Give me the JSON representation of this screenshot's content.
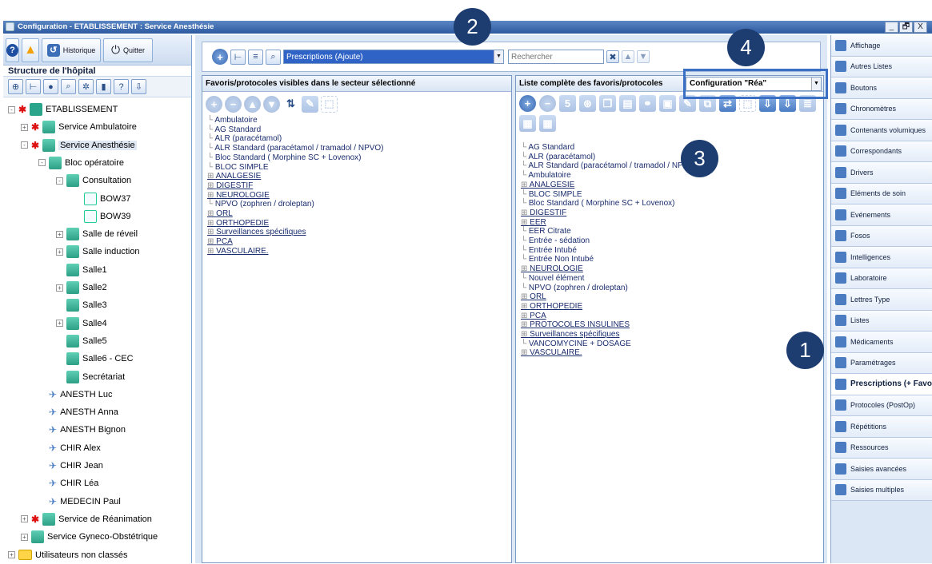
{
  "window": {
    "title": "Configuration - ETABLISSEMENT : Service Anesthésie",
    "buttons": [
      "_",
      "🗗",
      "X"
    ]
  },
  "left": {
    "historique_label": "Historique",
    "quitter_label": "Quitter",
    "structure_header": "Structure de l'hôpital",
    "tree": [
      {
        "label": "ETABLISSEMENT",
        "level": 0,
        "exp": "-",
        "icon": "establishment"
      },
      {
        "label": "Service Ambulatoire",
        "level": 1,
        "exp": "+",
        "icon": "service"
      },
      {
        "label": "Service Anesthésie",
        "level": 1,
        "exp": "-",
        "icon": "service",
        "selected": true
      },
      {
        "label": "Bloc opératoire",
        "level": 2,
        "exp": "-",
        "icon": "bloc"
      },
      {
        "label": "Consultation",
        "level": 3,
        "exp": "-",
        "icon": "room"
      },
      {
        "label": "BOW37",
        "level": 4,
        "exp": "",
        "icon": "desk"
      },
      {
        "label": "BOW39",
        "level": 4,
        "exp": "",
        "icon": "desk"
      },
      {
        "label": "Salle de réveil",
        "level": 3,
        "exp": "+",
        "icon": "room"
      },
      {
        "label": "Salle induction",
        "level": 3,
        "exp": "+",
        "icon": "room"
      },
      {
        "label": "Salle1",
        "level": 3,
        "exp": "",
        "icon": "room"
      },
      {
        "label": "Salle2",
        "level": 3,
        "exp": "+",
        "icon": "room"
      },
      {
        "label": "Salle3",
        "level": 3,
        "exp": "",
        "icon": "room"
      },
      {
        "label": "Salle4",
        "level": 3,
        "exp": "+",
        "icon": "room"
      },
      {
        "label": "Salle5",
        "level": 3,
        "exp": "",
        "icon": "room"
      },
      {
        "label": "Salle6 - CEC",
        "level": 3,
        "exp": "",
        "icon": "room"
      },
      {
        "label": "Secrétariat",
        "level": 3,
        "exp": "",
        "icon": "room"
      },
      {
        "label": "ANESTH Luc",
        "level": 2,
        "exp": "",
        "icon": "person"
      },
      {
        "label": "ANESTH Anna",
        "level": 2,
        "exp": "",
        "icon": "person"
      },
      {
        "label": "ANESTH Bignon",
        "level": 2,
        "exp": "",
        "icon": "person"
      },
      {
        "label": "CHIR Alex",
        "level": 2,
        "exp": "",
        "icon": "person"
      },
      {
        "label": "CHIR Jean",
        "level": 2,
        "exp": "",
        "icon": "person"
      },
      {
        "label": "CHIR Léa",
        "level": 2,
        "exp": "",
        "icon": "person"
      },
      {
        "label": "MEDECIN Paul",
        "level": 2,
        "exp": "",
        "icon": "person"
      },
      {
        "label": "Service de Réanimation",
        "level": 1,
        "exp": "+",
        "icon": "service"
      },
      {
        "label": "Service Gyneco-Obstétrique",
        "level": 1,
        "exp": "+",
        "icon": "service-plain"
      },
      {
        "label": "Utilisateurs non classés",
        "level": 0,
        "exp": "+",
        "icon": "folder"
      }
    ]
  },
  "main": {
    "prescriptions_combo": "Prescriptions (Ajoute)",
    "search_placeholder": "Rechercher",
    "panel_a_title": "Favoris/protocoles visibles dans le secteur sélectionné",
    "panel_b_title": "Liste complète des favoris/protocoles",
    "config_combo": "Configuration \"Réa\"",
    "list_a": [
      {
        "t": "Ambulatoire",
        "g": false
      },
      {
        "t": "AG Standard",
        "g": false
      },
      {
        "t": "ALR (paracétamol)",
        "g": false
      },
      {
        "t": "ALR Standard (paracétamol / tramadol / NPVO)",
        "g": false
      },
      {
        "t": "Bloc Standard ( Morphine SC + Lovenox)",
        "g": false
      },
      {
        "t": "BLOC SIMPLE",
        "g": false
      },
      {
        "t": "ANALGESIE",
        "g": true
      },
      {
        "t": "DIGESTIF",
        "g": true
      },
      {
        "t": "NEUROLOGIE",
        "g": true
      },
      {
        "t": "NPVO (zophren / droleptan)",
        "g": false
      },
      {
        "t": "ORL",
        "g": true
      },
      {
        "t": "ORTHOPEDIE",
        "g": true
      },
      {
        "t": "Surveillances spécifiques",
        "g": true
      },
      {
        "t": "PCA",
        "g": true
      },
      {
        "t": "VASCULAIRE.",
        "g": true
      }
    ],
    "list_b": [
      {
        "t": "AG Standard",
        "g": false
      },
      {
        "t": "ALR (paracétamol)",
        "g": false
      },
      {
        "t": "ALR Standard (paracétamol / tramadol / NPVO)",
        "g": false
      },
      {
        "t": "Ambulatoire",
        "g": false
      },
      {
        "t": "ANALGESIE",
        "g": true
      },
      {
        "t": "BLOC SIMPLE",
        "g": false
      },
      {
        "t": "Bloc Standard ( Morphine SC + Lovenox)",
        "g": false
      },
      {
        "t": "DIGESTIF",
        "g": true
      },
      {
        "t": "EER",
        "g": true
      },
      {
        "t": "EER Citrate",
        "g": false
      },
      {
        "t": "Entrée - sédation",
        "g": false
      },
      {
        "t": "Entrée Intubé",
        "g": false
      },
      {
        "t": "Entrée Non Intubé",
        "g": false
      },
      {
        "t": "NEUROLOGIE",
        "g": true
      },
      {
        "t": "Nouvel élément",
        "g": false
      },
      {
        "t": "NPVO (zophren / droleptan)",
        "g": false
      },
      {
        "t": "ORL",
        "g": true
      },
      {
        "t": "ORTHOPEDIE",
        "g": true
      },
      {
        "t": "PCA",
        "g": true
      },
      {
        "t": "PROTOCOLES INSULINES",
        "g": true
      },
      {
        "t": "Surveillances spécifiques",
        "g": true
      },
      {
        "t": "VANCOMYCINE + DOSAGE",
        "g": false
      },
      {
        "t": "VASCULAIRE.",
        "g": true
      }
    ]
  },
  "right": {
    "items": [
      {
        "label": "Affichage",
        "icon": "display-icon"
      },
      {
        "label": "Autres Listes",
        "icon": "list-icon"
      },
      {
        "label": "Boutons",
        "icon": "buttons-icon"
      },
      {
        "label": "Chronomètres",
        "icon": "clock-icon"
      },
      {
        "label": "Contenants volumiques",
        "icon": "syringe-icon"
      },
      {
        "label": "Correspondants",
        "icon": "contacts-icon"
      },
      {
        "label": "Drivers",
        "icon": "drivers-icon"
      },
      {
        "label": "Eléments de soin",
        "icon": "care-icon"
      },
      {
        "label": "Evénements",
        "icon": "events-icon"
      },
      {
        "label": "Fosos",
        "icon": "fosos-icon"
      },
      {
        "label": "Intelligences",
        "icon": "intelligence-icon"
      },
      {
        "label": "Laboratoire",
        "icon": "lab-icon"
      },
      {
        "label": "Lettres Type",
        "icon": "letters-icon"
      },
      {
        "label": "Listes",
        "icon": "lists-icon"
      },
      {
        "label": "Médicaments",
        "icon": "drugs-icon"
      },
      {
        "label": "Paramétrages",
        "icon": "settings-icon"
      },
      {
        "label": "Prescriptions (+ Favoris)",
        "icon": "prescriptions-icon",
        "active": true
      },
      {
        "label": "Protocoles (PostOp)",
        "icon": "protocols-icon"
      },
      {
        "label": "Répétitions",
        "icon": "repeat-icon"
      },
      {
        "label": "Ressources",
        "icon": "resources-icon"
      },
      {
        "label": "Saisies avancées",
        "icon": "advanced-entry-icon"
      },
      {
        "label": "Saisies multiples",
        "icon": "multi-entry-icon"
      }
    ]
  },
  "badges": [
    "1",
    "2",
    "3",
    "4"
  ],
  "colors": {
    "titlebar": "#2d5aa0",
    "badge": "#1d3d70",
    "callout": "#3a6fc4",
    "link": "#1a2d6e"
  }
}
